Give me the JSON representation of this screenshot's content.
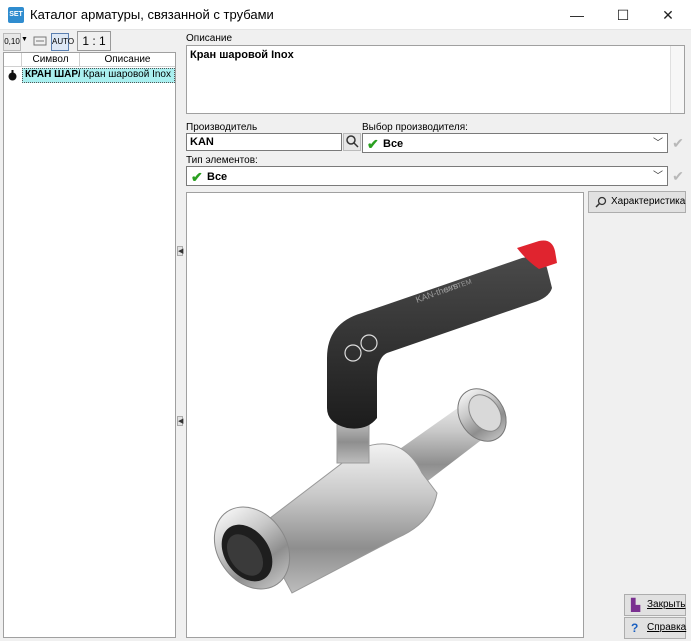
{
  "window": {
    "title": "Каталог арматуры, связанной с трубами",
    "app_icon_text": "SET",
    "minimize": "—",
    "maximize": "☐",
    "close": "✕"
  },
  "toolbar": {
    "ratio_label": "1 : 1",
    "btn1_text": "0,10",
    "btn2_text": "AUTO"
  },
  "list": {
    "columns": [
      "Символ",
      "Описание"
    ],
    "rows": [
      {
        "symbol": "КРАН ШАР/",
        "description": "Кран шаровой Inox"
      }
    ]
  },
  "form": {
    "description_label": "Описание",
    "description_value": "Кран шаровой Inox",
    "manufacturer_label": "Производитель",
    "manufacturer_value": "KAN",
    "manufacturer_select_label": "Выбор производителя:",
    "manufacturer_select_value": "Все",
    "element_type_label": "Тип элементов:",
    "element_type_value": "Все"
  },
  "buttons": {
    "characteristics": "Характеристика",
    "close": "Закрыть",
    "help": "Справка"
  },
  "image": {
    "brand_text": "KAN-therm",
    "system_text": "SYSTEM"
  },
  "colors": {
    "accent_check": "#2aa020",
    "selected_row": "#aaf0f0",
    "handle_red": "#e0242f"
  }
}
